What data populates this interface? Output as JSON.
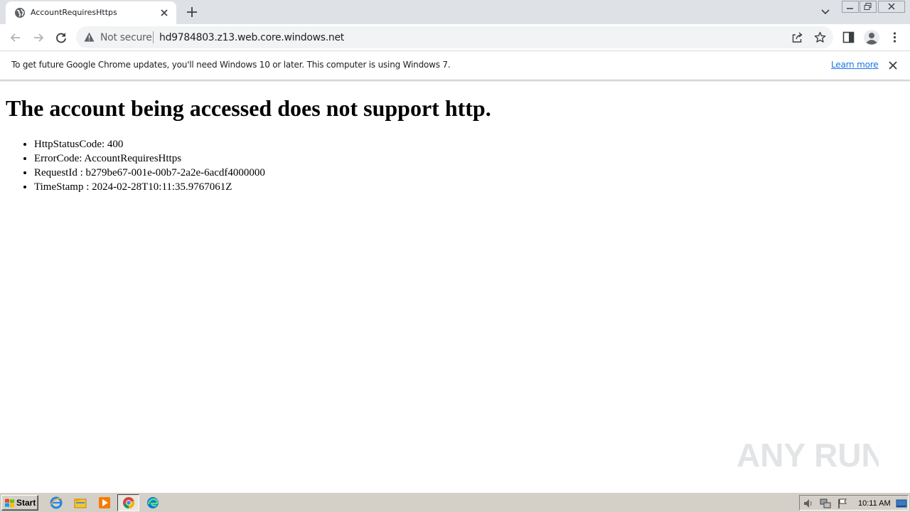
{
  "tab": {
    "title": "AccountRequiresHttps"
  },
  "toolbar": {
    "security_label": "Not secure",
    "url": "hd9784803.z13.web.core.windows.net"
  },
  "infobar": {
    "message": "To get future Google Chrome updates, you'll need Windows 10 or later. This computer is using Windows 7.",
    "link_label": "Learn more"
  },
  "page": {
    "heading": "The account being accessed does not support http.",
    "items": [
      "HttpStatusCode: 400",
      "ErrorCode: AccountRequiresHttps",
      "RequestId : b279be67-001e-00b7-2a2e-6acdf4000000",
      "TimeStamp : 2024-02-28T10:11:35.9767061Z"
    ]
  },
  "watermark": {
    "text": "ANY RUN"
  },
  "taskbar": {
    "start_label": "Start",
    "clock": "10:11 AM"
  },
  "colors": {
    "tabstrip": "#dee1e6",
    "link": "#1a73e8",
    "taskbar": "#d4d0c8"
  },
  "icons": {
    "tab": "globe-icon",
    "security": "warning-triangle-icon",
    "taskbar_apps": [
      "internet-explorer-icon",
      "file-explorer-icon",
      "media-player-icon",
      "chrome-icon",
      "edge-icon"
    ]
  }
}
